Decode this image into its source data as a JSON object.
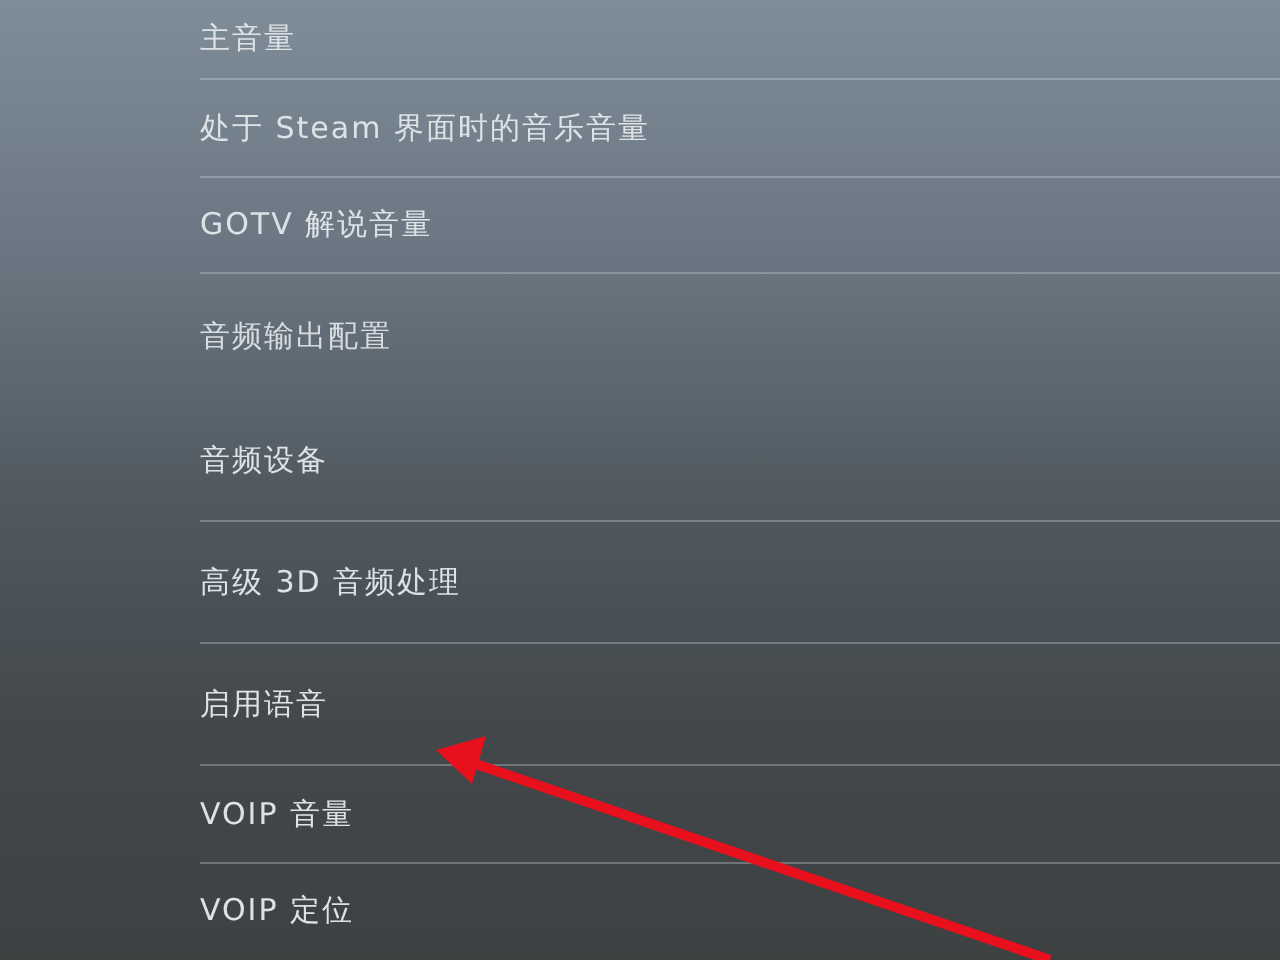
{
  "settings": [
    {
      "label": "主音量",
      "kind": "setting"
    },
    {
      "label": "处于 Steam 界面时的音乐音量",
      "kind": "setting"
    },
    {
      "label": "GOTV 解说音量",
      "kind": "setting"
    },
    {
      "label": "音频输出配置",
      "kind": "section"
    },
    {
      "label": "音频设备",
      "kind": "setting"
    },
    {
      "label": "高级 3D 音频处理",
      "kind": "setting"
    },
    {
      "label": "启用语音",
      "kind": "setting"
    },
    {
      "label": "VOIP 音量",
      "kind": "setting"
    },
    {
      "label": "VOIP 定位",
      "kind": "setting"
    }
  ]
}
